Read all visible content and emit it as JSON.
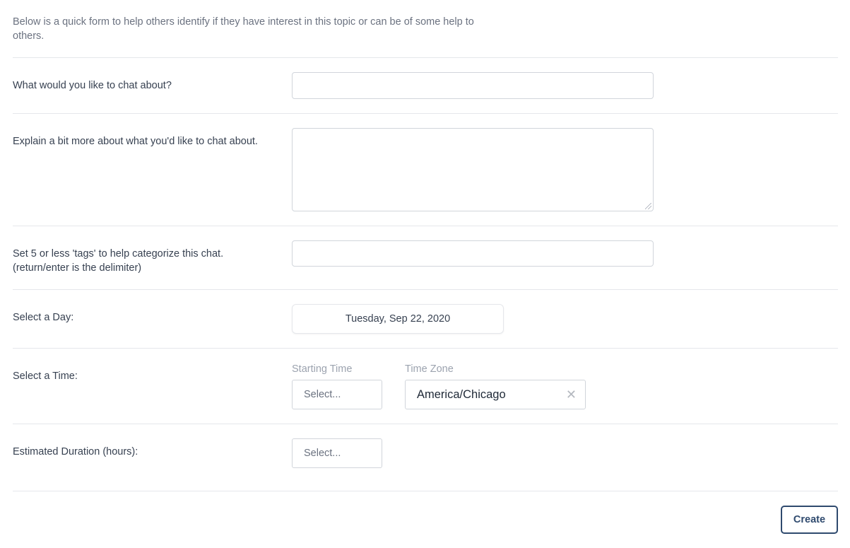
{
  "intro": "Below is a quick form to help others identify if they have interest in this topic or can be of some help to others.",
  "fields": {
    "topic_label": "What would you like to chat about?",
    "topic_value": "",
    "details_label": "Explain a bit more about what you'd like to chat about.",
    "details_value": "",
    "tags_label_line1": "Set 5 or less 'tags' to help categorize this chat.",
    "tags_label_line2": "(return/enter is the delimiter)",
    "tags_value": "",
    "day_label": "Select a Day:",
    "day_value": "Tuesday, Sep 22, 2020",
    "time_label": "Select a Time:",
    "starting_time_label": "Starting Time",
    "starting_time_placeholder": "Select...",
    "timezone_label": "Time Zone",
    "timezone_value": "America/Chicago",
    "clear_icon": "close-icon",
    "duration_label": "Estimated Duration (hours):",
    "duration_placeholder": "Select..."
  },
  "actions": {
    "create_label": "Create"
  },
  "colors": {
    "primary_button": "#2f4a6e",
    "border": "#d1d5db",
    "divider": "#e5e7eb"
  }
}
